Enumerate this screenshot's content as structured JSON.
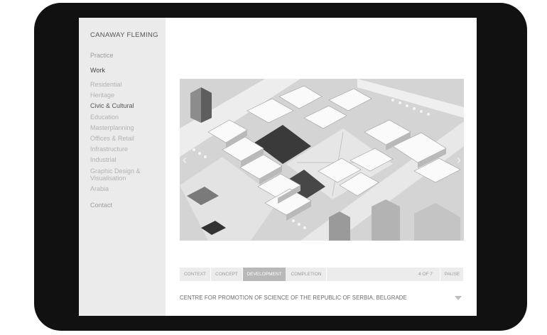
{
  "brand": "CANAWAY FLEMING",
  "nav": {
    "practice": "Practice",
    "work": "Work",
    "contact": "Contact"
  },
  "categories": [
    {
      "label": "Residential"
    },
    {
      "label": "Heritage"
    },
    {
      "label": "Civic & Cultural",
      "active": true
    },
    {
      "label": "Education"
    },
    {
      "label": "Masterplanning"
    },
    {
      "label": "Offices & Retail"
    },
    {
      "label": "Infrastructure"
    },
    {
      "label": "Industrial"
    },
    {
      "label": "Graphic Design & Visualisation"
    },
    {
      "label": "Arabia"
    }
  ],
  "slideshow": {
    "image_description_icon": "architectural-model-image",
    "prev_arrow": "‹",
    "next_arrow": "›",
    "tabs": [
      "CONTEXT",
      "CONCEPT",
      "DEVELOPMENT",
      "COMPLETION"
    ],
    "active_tab": "DEVELOPMENT",
    "counter": "4 OF 7",
    "pause_label": "PAUSE"
  },
  "project": {
    "caption": "CENTRE FOR PROMOTION OF SCIENCE OF THE REPUBLIC OF SERBIA, BELGRADE"
  }
}
